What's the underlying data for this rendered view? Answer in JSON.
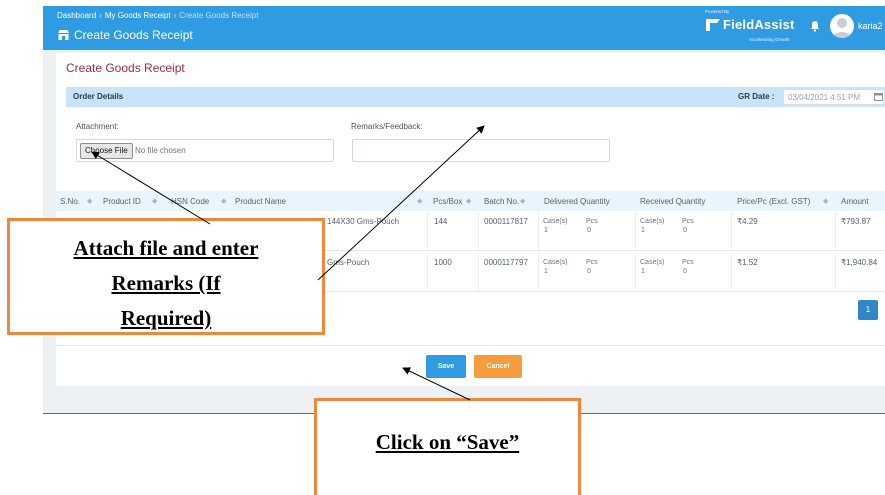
{
  "breadcrumb": {
    "home": "Dashboard",
    "section": "My Goods Receipt",
    "current": "Create Goods Receipt"
  },
  "header": {
    "title": "Create Goods Receipt",
    "brand_powered": "Powered By",
    "brand_name": "FieldAssist",
    "brand_tagline": "Accelerating Growth",
    "username": "karia2"
  },
  "form": {
    "card_title": "Create Goods Receipt",
    "section_title": "Order Details",
    "gr_date_label": "GR Date :",
    "gr_date_value": "03/04/2021 4:51 PM",
    "attachment_label": "Attachment:",
    "choose_file_label": "Choose File",
    "no_file_text": "No file chosen",
    "remarks_label": "Remarks/Feedback:",
    "remarks_value": ""
  },
  "table": {
    "columns": [
      "S.No.",
      "Product ID",
      "HSN Code",
      "Product Name",
      "Pcs/Box",
      "Batch No.",
      "Delivered Quantity",
      "Received Quantity",
      "Price/Pc (Excl. GST)",
      "Amount"
    ],
    "rows": [
      {
        "product_name": "144X30 Gms-Pouch",
        "pcs_box": "144",
        "batch": "0000117817",
        "delivered_cases_label": "Case(s)",
        "delivered_cases": "1",
        "delivered_pcs_label": "Pcs",
        "delivered_pcs": "0",
        "received_cases_label": "Case(s)",
        "received_cases": "1",
        "received_pcs_label": "Pcs",
        "received_pcs": "0",
        "price": "₹4.29",
        "amount": "₹793.87"
      },
      {
        "product_name": "Gms-Pouch",
        "pcs_box": "1000",
        "batch": "0000117797",
        "delivered_cases_label": "Case(s)",
        "delivered_cases": "1",
        "delivered_pcs_label": "Pcs",
        "delivered_pcs": "0",
        "received_cases_label": "Case(s)",
        "received_cases": "1",
        "received_pcs_label": "Pcs",
        "received_pcs": "0",
        "price": "₹1.52",
        "amount": "₹1,940.84"
      }
    ],
    "current_page": "1"
  },
  "actions": {
    "save_label": "Save",
    "cancel_label": "Cancel"
  },
  "annotations": {
    "attach_line1": "Attach file and enter",
    "attach_line2": "Remarks (If",
    "attach_line3": "Required)",
    "save_text": "Click on “Save”"
  },
  "colors": {
    "topbar": "#2f9be3",
    "card_title": "#9b2d3a",
    "section_bar": "#c7e4fa",
    "save": "#2f9be3",
    "cancel": "#f59d3b",
    "callout_border": "#f0883a",
    "pager": "#2f86c9"
  },
  "icons": [
    "store-icon",
    "bell-icon",
    "calendar-icon",
    "sort-icon",
    "user-avatar"
  ]
}
